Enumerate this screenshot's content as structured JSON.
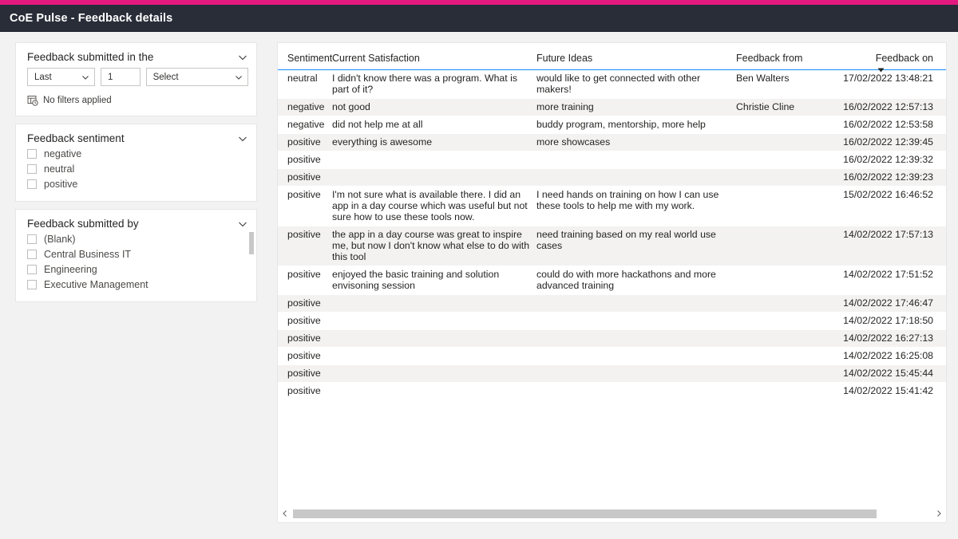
{
  "header": {
    "title": "CoE Pulse - Feedback details",
    "accent_color": "#e3197f",
    "bar_color": "#292d38"
  },
  "filters": {
    "date_card": {
      "title": "Feedback submitted in the",
      "collapse_icon": "chevron-down-icon",
      "period": "Last",
      "count": "1",
      "unit": "Select",
      "status": "No filters applied",
      "status_icon": "filter-clock-icon"
    },
    "sentiment_card": {
      "title": "Feedback sentiment",
      "collapse_icon": "chevron-down-icon",
      "options": [
        {
          "label": "negative",
          "checked": false
        },
        {
          "label": "neutral",
          "checked": false
        },
        {
          "label": "positive",
          "checked": false
        }
      ]
    },
    "submitted_by_card": {
      "title": "Feedback submitted by",
      "collapse_icon": "chevron-down-icon",
      "options": [
        {
          "label": "(Blank)",
          "checked": false
        },
        {
          "label": "Central Business IT",
          "checked": false
        },
        {
          "label": "Engineering",
          "checked": false
        },
        {
          "label": "Executive Management",
          "checked": false
        }
      ]
    }
  },
  "table": {
    "columns": [
      {
        "key": "sentiment",
        "label": "Sentiment"
      },
      {
        "key": "satisfaction",
        "label": "Current Satisfaction"
      },
      {
        "key": "ideas",
        "label": "Future Ideas"
      },
      {
        "key": "from",
        "label": "Feedback from"
      },
      {
        "key": "on",
        "label": "Feedback on"
      }
    ],
    "sort": {
      "column": "Feedback on",
      "direction": "descending",
      "icon": "sort-descending-arrow-icon"
    },
    "header_underline_color": "#118dff",
    "rows": [
      {
        "sentiment": "neutral",
        "satisfaction": "I didn't know there was a program. What is part of it?",
        "ideas": "would like to get connected with other makers!",
        "from": "Ben Walters",
        "on": "17/02/2022 13:48:21"
      },
      {
        "sentiment": "negative",
        "satisfaction": "not good",
        "ideas": "more training",
        "from": "Christie Cline",
        "on": "16/02/2022 12:57:13"
      },
      {
        "sentiment": "negative",
        "satisfaction": "did not help me at all",
        "ideas": "buddy program, mentorship, more help",
        "from": "",
        "on": "16/02/2022 12:53:58"
      },
      {
        "sentiment": "positive",
        "satisfaction": "everything is awesome",
        "ideas": "more showcases",
        "from": "",
        "on": "16/02/2022 12:39:45"
      },
      {
        "sentiment": "positive",
        "satisfaction": "",
        "ideas": "",
        "from": "",
        "on": "16/02/2022 12:39:32"
      },
      {
        "sentiment": "positive",
        "satisfaction": "",
        "ideas": "",
        "from": "",
        "on": "16/02/2022 12:39:23"
      },
      {
        "sentiment": "positive",
        "satisfaction": "I'm not sure what is available there. I did an app in a day course which was useful but not sure how to use these tools now.",
        "ideas": "I need hands on training on how I can use these tools to help me with my work.",
        "from": "",
        "on": "15/02/2022 16:46:52"
      },
      {
        "sentiment": "positive",
        "satisfaction": "the app in a day course was great to inspire me, but now I don't know what else to do with this tool",
        "ideas": "need training based on my real world use cases",
        "from": "",
        "on": "14/02/2022 17:57:13"
      },
      {
        "sentiment": "positive",
        "satisfaction": "enjoyed the basic training and solution envisoning session",
        "ideas": "could do with more hackathons and more advanced training",
        "from": "",
        "on": "14/02/2022 17:51:52"
      },
      {
        "sentiment": "positive",
        "satisfaction": "",
        "ideas": "",
        "from": "",
        "on": "14/02/2022 17:46:47"
      },
      {
        "sentiment": "positive",
        "satisfaction": "",
        "ideas": "",
        "from": "",
        "on": "14/02/2022 17:18:50"
      },
      {
        "sentiment": "positive",
        "satisfaction": "",
        "ideas": "",
        "from": "",
        "on": "14/02/2022 16:27:13"
      },
      {
        "sentiment": "positive",
        "satisfaction": "",
        "ideas": "",
        "from": "",
        "on": "14/02/2022 16:25:08"
      },
      {
        "sentiment": "positive",
        "satisfaction": "",
        "ideas": "",
        "from": "",
        "on": "14/02/2022 15:45:44"
      },
      {
        "sentiment": "positive",
        "satisfaction": "",
        "ideas": "",
        "from": "",
        "on": "14/02/2022 15:41:42"
      }
    ],
    "h_scroll": {
      "left_icon": "chevron-left-icon",
      "right_icon": "chevron-right-icon"
    }
  }
}
